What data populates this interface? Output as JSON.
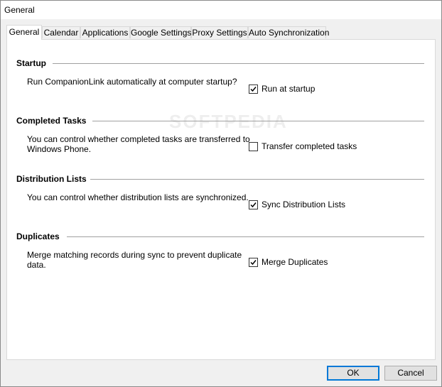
{
  "window": {
    "title": "General"
  },
  "tabs": [
    {
      "label": "General",
      "active": true
    },
    {
      "label": "Calendar"
    },
    {
      "label": "Applications"
    },
    {
      "label": "Google Settings"
    },
    {
      "label": "Proxy Settings"
    },
    {
      "label": "Auto Synchronization"
    }
  ],
  "sections": {
    "startup": {
      "title": "Startup",
      "description": "Run CompanionLink automatically at computer startup?",
      "checkbox_label": "Run at startup",
      "checked": true
    },
    "completed_tasks": {
      "title": "Completed Tasks",
      "description_line1": "You can control whether completed tasks are transferred to",
      "description_line2": "Windows Phone.",
      "checkbox_label": "Transfer completed tasks",
      "checked": false
    },
    "distribution_lists": {
      "title": "Distribution Lists",
      "description": "You can control whether distribution lists are synchronized.",
      "checkbox_label": "Sync Distribution Lists",
      "checked": true
    },
    "duplicates": {
      "title": "Duplicates",
      "description_line1": "Merge matching records during sync to prevent duplicate",
      "description_line2": "data.",
      "checkbox_label": "Merge Duplicates",
      "checked": true
    }
  },
  "buttons": {
    "ok": "OK",
    "cancel": "Cancel"
  },
  "colors": {
    "accent": "#0078d7",
    "window_bg": "#f0f0f0",
    "panel_bg": "#ffffff"
  }
}
